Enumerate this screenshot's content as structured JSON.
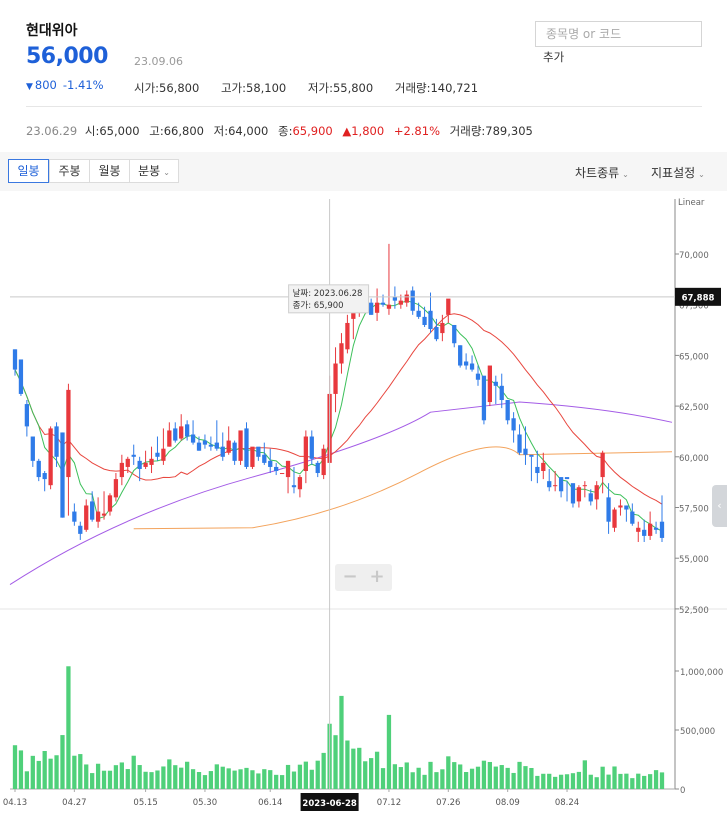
{
  "stock": {
    "name": "현대위아",
    "price": "56,000",
    "date": "23.09.06",
    "change_symbol": "▼",
    "change_amount": "800",
    "change_pct": "-1.41%",
    "open_label": "시가",
    "open": "56,800",
    "high_label": "고가",
    "high": "58,100",
    "low_label": "저가",
    "low": "55,800",
    "volume_label": "거래량",
    "volume": "140,721"
  },
  "search": {
    "placeholder": "종목명 or 코드",
    "add_label": "추가"
  },
  "prev_day": {
    "date": "23.06.29",
    "open_label": "시",
    "open": "65,000",
    "high_label": "고",
    "high": "66,800",
    "low_label": "저",
    "low": "64,000",
    "close_label": "종",
    "close": "65,900",
    "change_symbol": "▲",
    "change_amount": "1,800",
    "change_pct": "+2.81%",
    "volume_label": "거래량",
    "volume": "789,305"
  },
  "toolbar": {
    "tabs": [
      "일봉",
      "주봉",
      "월봉",
      "분봉"
    ],
    "active_tab": "일봉",
    "chart_type_label": "차트종류",
    "indicator_label": "지표설정",
    "chevron_icon": "chevron-down-icon"
  },
  "tooltip": {
    "date_label": "날짜",
    "date": "2023.06.28",
    "close_label": "종가",
    "close": "65,900"
  },
  "crosshair_date_label": "2023-06-28",
  "zoom": {
    "minus": "−",
    "plus": "+"
  },
  "colors": {
    "up": "#e8383d",
    "down": "#2f7be8",
    "volume": "#4fd07a",
    "ma5": "#3cc05a",
    "ma20": "#e8473f",
    "ma60": "#a45ce6",
    "ma120": "#f3a35c",
    "accent": "#1e60d8"
  },
  "chart_data": {
    "type": "candlestick",
    "scale_label": "Linear",
    "y_ticks": [
      "70,000",
      "67,500",
      "65,000",
      "62,500",
      "60,000",
      "57,500",
      "55,000",
      "52,500"
    ],
    "y_tick_values": [
      70000,
      67500,
      65000,
      62500,
      60000,
      57500,
      55000,
      52500
    ],
    "y_range": [
      52500,
      72000
    ],
    "crosshair_price_label": "67,888",
    "crosshair_price": 67888,
    "crosshair_index": 53,
    "x_tick_labels": [
      "04.13",
      "04.27",
      "05.15",
      "05.30",
      "06.14",
      "07.12",
      "07.26",
      "08.09",
      "08.24"
    ],
    "x_tick_indices": [
      0,
      10,
      22,
      32,
      43,
      63,
      73,
      83,
      93
    ],
    "volume_ticks": [
      "1,000,000",
      "500,000",
      "0"
    ],
    "volume_tick_values": [
      1000000,
      500000,
      0
    ],
    "volume_range": [
      0,
      1250000
    ],
    "candles": [
      [
        65300,
        65300,
        64300,
        64000,
        371000
      ],
      [
        64800,
        64300,
        63100,
        63000,
        327000
      ],
      [
        62600,
        62800,
        61500,
        61000,
        150000
      ],
      [
        61000,
        61000,
        59800,
        59500,
        281000
      ],
      [
        59800,
        59900,
        59000,
        58800,
        238000
      ],
      [
        59200,
        59300,
        58900,
        58300,
        322000
      ],
      [
        58600,
        61500,
        61400,
        58400,
        257000
      ],
      [
        61500,
        61700,
        60000,
        59500,
        286000
      ],
      [
        61200,
        61200,
        57000,
        57000,
        457000
      ],
      [
        59000,
        63600,
        63300,
        57100,
        1040000
      ],
      [
        57300,
        57700,
        56800,
        56600,
        282000
      ],
      [
        56600,
        56800,
        56200,
        55900,
        296000
      ],
      [
        56400,
        57900,
        57600,
        56300,
        208000
      ],
      [
        57800,
        58300,
        56900,
        56800,
        135000
      ],
      [
        56800,
        58000,
        57300,
        56500,
        214000
      ],
      [
        57100,
        58300,
        57200,
        56900,
        155000
      ],
      [
        57300,
        58200,
        58100,
        57100,
        155000
      ],
      [
        58000,
        59200,
        58900,
        57800,
        202000
      ],
      [
        59000,
        60100,
        59700,
        58600,
        225000
      ],
      [
        59500,
        60000,
        59900,
        59200,
        169000
      ],
      [
        60100,
        60600,
        60000,
        59600,
        282000
      ],
      [
        59800,
        60000,
        59400,
        58800,
        203000
      ],
      [
        59500,
        60300,
        59700,
        59400,
        146000
      ],
      [
        59600,
        60500,
        59900,
        59200,
        143000
      ],
      [
        60200,
        61000,
        60000,
        59800,
        157000
      ],
      [
        59800,
        61400,
        60400,
        59600,
        191000
      ],
      [
        60500,
        61700,
        61300,
        60500,
        251000
      ],
      [
        61400,
        61700,
        60800,
        60700,
        202000
      ],
      [
        60900,
        62100,
        61500,
        60800,
        181000
      ],
      [
        61600,
        61800,
        61000,
        60800,
        231000
      ],
      [
        61100,
        61800,
        60700,
        60600,
        168000
      ],
      [
        60700,
        61000,
        60300,
        60300,
        144000
      ],
      [
        60800,
        61100,
        60600,
        60400,
        118000
      ],
      [
        60600,
        61000,
        60500,
        60300,
        152000
      ],
      [
        60700,
        61800,
        60400,
        60300,
        209000
      ],
      [
        60500,
        61200,
        60000,
        59800,
        189000
      ],
      [
        60200,
        61500,
        60800,
        60100,
        175000
      ],
      [
        60700,
        60800,
        59800,
        59600,
        156000
      ],
      [
        59800,
        61200,
        61300,
        59600,
        167000
      ],
      [
        61400,
        61700,
        59500,
        59400,
        179000
      ],
      [
        59500,
        60300,
        60500,
        59400,
        159000
      ],
      [
        60500,
        60300,
        60000,
        59800,
        132000
      ],
      [
        60100,
        60700,
        59700,
        59600,
        168000
      ],
      [
        59800,
        60400,
        59500,
        59200,
        160000
      ],
      [
        59500,
        59700,
        59300,
        59100,
        120000
      ],
      [
        59200,
        59200,
        59200,
        59200,
        118000
      ],
      [
        59000,
        59800,
        59800,
        58200,
        204000
      ],
      [
        58600,
        59500,
        58500,
        58200,
        148000
      ],
      [
        58400,
        59100,
        59000,
        58000,
        206000
      ],
      [
        59300,
        61300,
        61000,
        58700,
        232000
      ],
      [
        61000,
        61300,
        59900,
        59600,
        163000
      ],
      [
        59700,
        59800,
        59200,
        59000,
        240000
      ],
      [
        59100,
        60600,
        60400,
        58900,
        306000
      ],
      [
        59700,
        64000,
        63100,
        59700,
        553000
      ],
      [
        63100,
        65400,
        64600,
        62200,
        456000
      ],
      [
        64600,
        66100,
        65600,
        64100,
        789000
      ],
      [
        65300,
        67000,
        66600,
        65100,
        411000
      ],
      [
        66800,
        68100,
        67500,
        65800,
        342000
      ],
      [
        67700,
        68500,
        68000,
        66900,
        349000
      ],
      [
        68000,
        68300,
        67600,
        67300,
        235000
      ],
      [
        67600,
        67800,
        67000,
        67000,
        262000
      ],
      [
        67100,
        68300,
        67600,
        66700,
        316000
      ],
      [
        67600,
        68000,
        67500,
        67400,
        177000
      ],
      [
        67300,
        70500,
        67500,
        67000,
        628000
      ],
      [
        67900,
        68400,
        67700,
        67300,
        210000
      ],
      [
        67500,
        68000,
        67700,
        67300,
        186000
      ],
      [
        67600,
        68200,
        68000,
        67400,
        225000
      ],
      [
        68200,
        68400,
        67200,
        67000,
        142000
      ],
      [
        67200,
        67600,
        66900,
        66800,
        180000
      ],
      [
        66900,
        67400,
        66500,
        66400,
        120000
      ],
      [
        67200,
        68100,
        66300,
        66100,
        230000
      ],
      [
        66400,
        66800,
        65800,
        65700,
        143000
      ],
      [
        66100,
        67000,
        66600,
        65700,
        167000
      ],
      [
        67000,
        67600,
        67800,
        66600,
        277000
      ],
      [
        66500,
        66500,
        65600,
        65400,
        228000
      ],
      [
        65500,
        65500,
        64500,
        64400,
        208000
      ],
      [
        64700,
        65100,
        64500,
        64300,
        144000
      ],
      [
        64600,
        65000,
        64300,
        64200,
        172000
      ],
      [
        64100,
        64500,
        63800,
        63500,
        189000
      ],
      [
        64000,
        63800,
        61800,
        61600,
        240000
      ],
      [
        62700,
        64000,
        64500,
        62500,
        229000
      ],
      [
        63700,
        64000,
        63500,
        62600,
        190000
      ],
      [
        63500,
        64100,
        62800,
        62400,
        203000
      ],
      [
        62800,
        62800,
        61800,
        61600,
        179000
      ],
      [
        61900,
        62200,
        61300,
        60700,
        136000
      ],
      [
        61100,
        61600,
        60200,
        60100,
        230000
      ],
      [
        60400,
        61500,
        60100,
        59600,
        194000
      ],
      [
        60100,
        60000,
        60000,
        58800,
        178000
      ],
      [
        59500,
        60300,
        59200,
        58700,
        111000
      ],
      [
        59300,
        60200,
        59700,
        58900,
        129000
      ],
      [
        58800,
        59400,
        58500,
        58300,
        129000
      ],
      [
        58600,
        59300,
        58600,
        58300,
        103000
      ],
      [
        59000,
        58900,
        58300,
        58000,
        121000
      ],
      [
        59000,
        58800,
        58900,
        57800,
        125000
      ],
      [
        58700,
        58500,
        57700,
        57500,
        134000
      ],
      [
        57800,
        58600,
        58500,
        57500,
        145000
      ],
      [
        58600,
        58800,
        58600,
        58000,
        243000
      ],
      [
        58200,
        58400,
        57800,
        57600,
        121000
      ],
      [
        57900,
        58800,
        58600,
        57400,
        100000
      ],
      [
        59000,
        60300,
        60200,
        58200,
        189000
      ],
      [
        58000,
        58700,
        56800,
        56200,
        122000
      ],
      [
        56500,
        57500,
        57400,
        56300,
        191000
      ],
      [
        57500,
        57900,
        57600,
        57100,
        128000
      ],
      [
        57600,
        57600,
        57400,
        56800,
        130000
      ],
      [
        57300,
        57700,
        56700,
        56600,
        92000
      ],
      [
        56300,
        56800,
        56500,
        55800,
        130000
      ],
      [
        56400,
        56900,
        56100,
        55800,
        111000
      ],
      [
        56100,
        57300,
        56700,
        55900,
        126000
      ],
      [
        56500,
        56800,
        56400,
        56200,
        160000
      ],
      [
        56800,
        58100,
        56000,
        55800,
        140721
      ]
    ]
  }
}
